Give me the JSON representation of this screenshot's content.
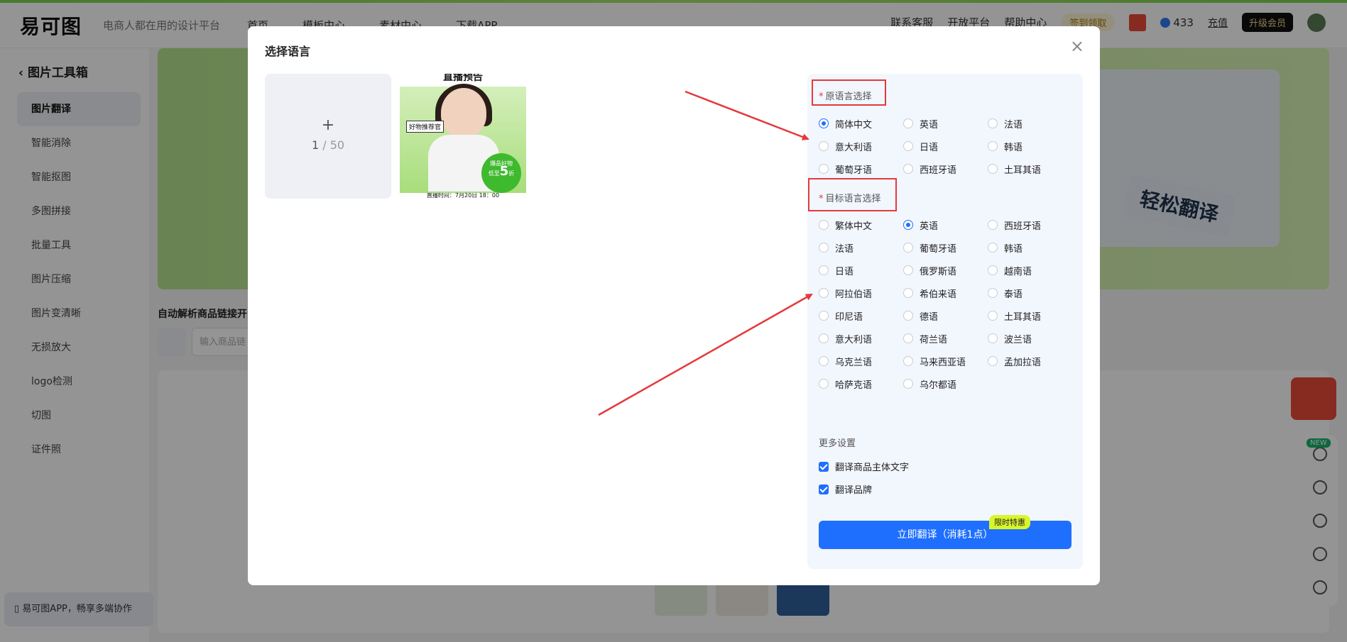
{
  "app": {
    "logo": "易可图",
    "slogan": "电商人都在用的设计平台",
    "nav": [
      "首页",
      "模板中心",
      "素材中心",
      "下载APP"
    ],
    "header_right": {
      "service": "联系客服",
      "open_platform": "开放平台",
      "help": "帮助中心",
      "checkin": "签到领取",
      "points": "433",
      "recharge": "充值",
      "upgrade": "升级会员"
    }
  },
  "sidebar": {
    "title": "图片工具箱",
    "items": [
      "图片翻译",
      "智能消除",
      "智能抠图",
      "多图拼接",
      "批量工具",
      "图片压缩",
      "图片变清晰",
      "无损放大",
      "logo检测",
      "切图",
      "证件照"
    ],
    "promo": "易可图APP，畅享多端协作"
  },
  "banner": {
    "tag": "轻松翻译"
  },
  "link_section": {
    "label": "自动解析商品链接开",
    "placeholder": "输入商品链"
  },
  "floatbar": {
    "new_badge": "NEW"
  },
  "modal": {
    "title": "选择语言",
    "close": "×",
    "upload": {
      "plus": "+",
      "count": "1",
      "sep": " / ",
      "max": "50"
    },
    "product": {
      "head": "直播预告",
      "sticker": "好物推荐官",
      "badge_line1": "爆品好物",
      "badge_line2": "低至",
      "badge_num": "5",
      "badge_unit": "折",
      "foot": "直播时间：7月20日 18：00"
    },
    "source": {
      "label": "原语言选择",
      "languages": [
        "简体中文",
        "英语",
        "法语",
        "意大利语",
        "日语",
        "韩语",
        "葡萄牙语",
        "西班牙语",
        "土耳其语"
      ],
      "selected": "简体中文"
    },
    "target": {
      "label": "目标语言选择",
      "languages": [
        "繁体中文",
        "英语",
        "西班牙语",
        "法语",
        "葡萄牙语",
        "韩语",
        "日语",
        "俄罗斯语",
        "越南语",
        "阿拉伯语",
        "希伯来语",
        "泰语",
        "印尼语",
        "德语",
        "土耳其语",
        "意大利语",
        "荷兰语",
        "波兰语",
        "乌克兰语",
        "马来西亚语",
        "孟加拉语",
        "哈萨克语",
        "乌尔都语"
      ],
      "selected": "英语"
    },
    "more": {
      "label": "更多设置",
      "options": [
        {
          "label": "翻译商品主体文字",
          "checked": true
        },
        {
          "label": "翻译品牌",
          "checked": true
        }
      ]
    },
    "submit": "立即翻译（消耗1点）",
    "promo_tag": "限时特惠"
  },
  "colors": {
    "primary": "#1f6fff",
    "highlight": "#e4393c",
    "promo": "#d8f62a"
  }
}
